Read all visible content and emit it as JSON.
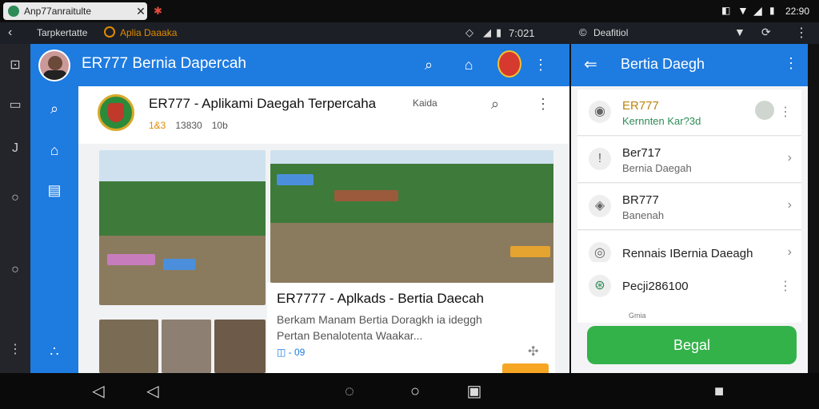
{
  "statusbar": {
    "tab_title": "Anp77anraitulte",
    "time": "22:90",
    "close_glyph": "✕"
  },
  "urlbar": {
    "left_label": "Tarpkertatte",
    "app_label": "Aplia Daaaka",
    "clock": "7:021",
    "right_label": "Deafitiol"
  },
  "appheader": {
    "title": "ER777  Bernia Dapercah"
  },
  "page": {
    "title": "ER777 - Aplikami Daegah Terpercaha",
    "meta_rating": "1&3",
    "meta_views": "13830",
    "meta_extra": "10b",
    "badge": "Kaida"
  },
  "card": {
    "title": "ER7777 - Aplkads - Bertia Daecah",
    "desc1": "Berkam Manam Bertia Doragkh ia ideggh",
    "desc2": "Pertan Benalotenta Waakar...",
    "tag": "- 09"
  },
  "rpanel": {
    "title": "Bertia Daegh",
    "items": [
      {
        "line1": "ER777",
        "line2": "Kernnten Kar?3d"
      },
      {
        "line1": "Ber717",
        "line2": "Bernia Daegah"
      },
      {
        "line1": "BR777",
        "line2": "Banenah"
      },
      {
        "line1": "Rennais IBernia Daeagh",
        "line2": ""
      },
      {
        "line1": "Pecji286100",
        "line2": ""
      }
    ],
    "small_note": "Gmia",
    "button_label": "Begal"
  },
  "colors": {
    "primary": "#1e7be0",
    "green": "#34b24a",
    "orange": "#f6a623"
  }
}
